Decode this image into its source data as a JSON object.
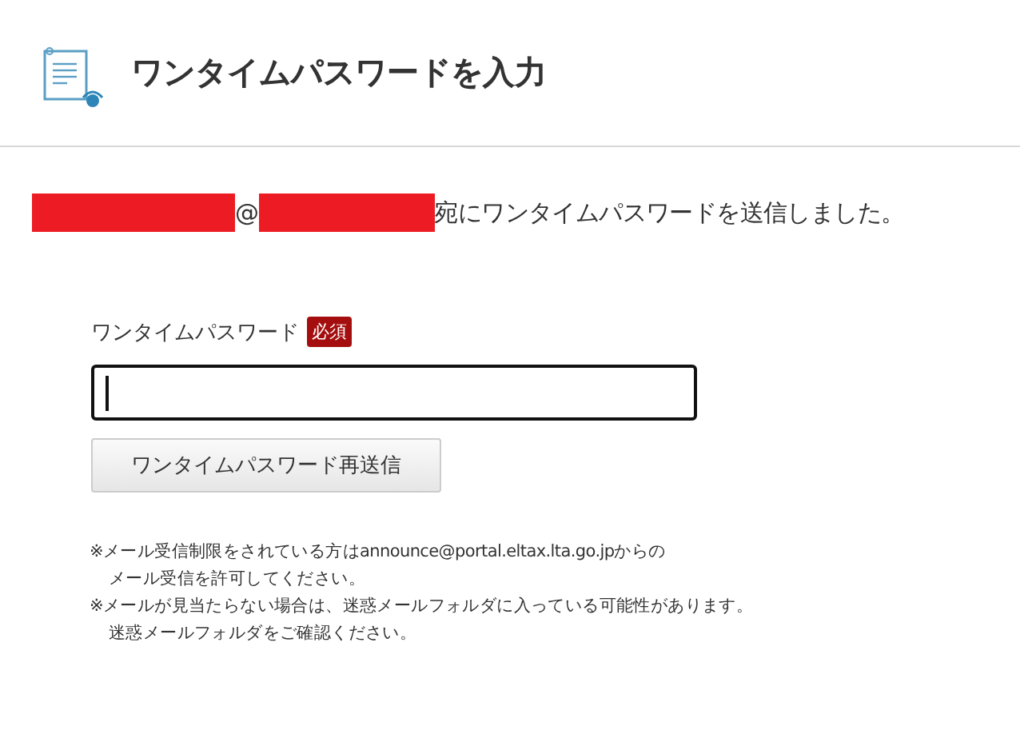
{
  "header": {
    "title": "ワンタイムパスワードを入力"
  },
  "message": {
    "parts": [
      {
        "kind": "redaction"
      },
      {
        "kind": "text",
        "text": "@"
      },
      {
        "kind": "redaction"
      },
      {
        "kind": "text",
        "text": "宛にワンタイムパスワードを送信しました。"
      }
    ]
  },
  "field": {
    "label": "ワンタイムパスワード",
    "required_badge": "必須",
    "focused": true
  },
  "resend_button": "ワンタイムパスワード再送信",
  "notes": [
    {
      "lines": [
        "※メール受信制限をされている方はannounce@portal.eltax.lta.go.jpからの",
        "メール受信を許可してください。"
      ]
    },
    {
      "lines": [
        "※メールが見当たらない場合は、迷惑メールフォルダに入っている可能性があります。",
        "迷惑メールフォルダをご確認ください。"
      ]
    }
  ]
}
